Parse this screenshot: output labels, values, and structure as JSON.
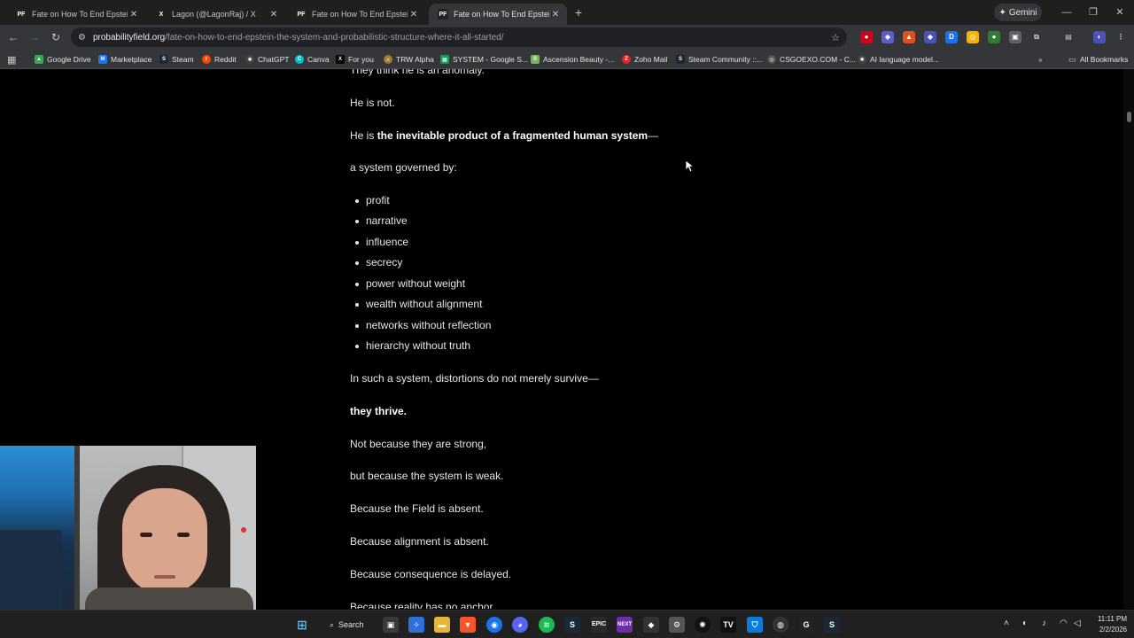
{
  "browser": {
    "tabs": [
      {
        "title": "Fate on How To End Epstein: Th",
        "favicon": "PF",
        "active": false
      },
      {
        "title": "Lagon (@LagonRaj) / X",
        "favicon": "X",
        "active": false
      },
      {
        "title": "Fate on How To End Epstein: Th",
        "favicon": "PF",
        "active": false
      },
      {
        "title": "Fate on How To End Epstein: Th",
        "favicon": "PF",
        "active": true
      }
    ],
    "new_tab": "+",
    "gemini_label": "Gemini",
    "url_domain": "probabilityfield.org",
    "url_path": "/fate-on-how-to-end-epstein-the-system-and-probabilistic-structure-where-it-all-started/"
  },
  "bookmarks": [
    {
      "label": "Google Drive",
      "icon": "drive-icon",
      "color": "#34a853"
    },
    {
      "label": "Marketplace",
      "icon": "marketplace-icon",
      "color": "#1877f2"
    },
    {
      "label": "Steam",
      "icon": "steam-icon",
      "color": "#1b2838"
    },
    {
      "label": "Reddit",
      "icon": "reddit-icon",
      "color": "#ff4500"
    },
    {
      "label": "ChatGPT",
      "icon": "chatgpt-icon",
      "color": "#444"
    },
    {
      "label": "Canva",
      "icon": "canva-icon",
      "color": "#00c4cc"
    },
    {
      "label": "For you",
      "icon": "x-icon",
      "color": "#000"
    },
    {
      "label": "TRW Alpha",
      "icon": "trw-icon",
      "color": "#a07a2c"
    },
    {
      "label": "SYSTEM - Google S...",
      "icon": "sheets-icon",
      "color": "#0f9d58"
    },
    {
      "label": "Ascension Beauty -...",
      "icon": "shopify-icon",
      "color": "#7ab55c"
    },
    {
      "label": "Zoho Mail",
      "icon": "zoho-icon",
      "color": "#e42527"
    },
    {
      "label": "Steam Community ::...",
      "icon": "steam-icon",
      "color": "#1b2838"
    },
    {
      "label": "CSGOEXO.COM - C...",
      "icon": "globe-icon",
      "color": "#555"
    },
    {
      "label": "AI language model...",
      "icon": "openai-icon",
      "color": "#444"
    }
  ],
  "all_bookmarks_label": "All Bookmarks",
  "article": {
    "partial_top": "They think he is an anomaly.",
    "p1": "He is not.",
    "p2_prefix": "He is ",
    "p2_bold": "the inevitable product of a fragmented human system",
    "p2_suffix": "—",
    "p3": "a system governed by:",
    "list": [
      "profit",
      "narrative",
      "influence",
      "secrecy",
      "power without weight",
      "wealth without alignment",
      "networks without reflection",
      "hierarchy without truth"
    ],
    "p4": "In such a system, distortions do not merely survive—",
    "p5_bold": "they thrive.",
    "p6": "Not because they are strong,",
    "p7": "but because the system is weak.",
    "p8": "Because the Field is absent.",
    "p9": "Because alignment is absent.",
    "p10": "Because consequence is delayed.",
    "p11": "Because reality has no anchor."
  },
  "taskbar": {
    "search_label": "Search",
    "time": "11:11 PM",
    "date": "2/2/2026"
  },
  "colors": {
    "tab_bg": "#1f1f1f",
    "toolbar_bg": "#35363a",
    "page_bg": "#000000",
    "text": "#e6e6e6"
  }
}
